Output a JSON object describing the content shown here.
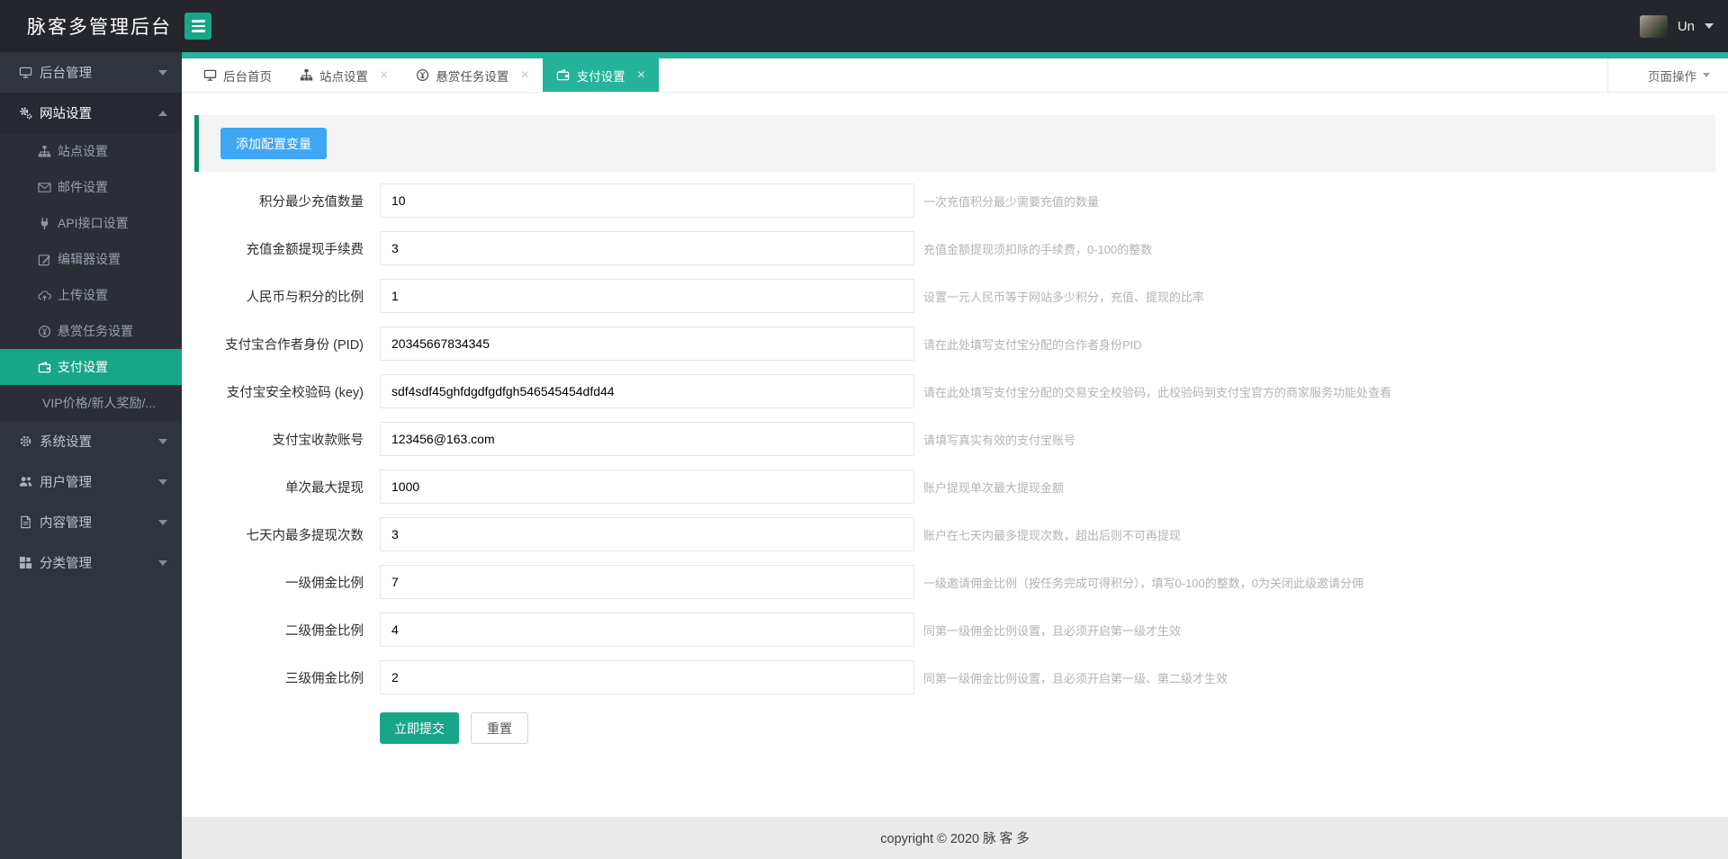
{
  "colors": {
    "accent": "#18A689",
    "tab_active": "#26B39B",
    "banner_bar": "#128D71",
    "blue": "#3FA7F3",
    "header_bg": "#24262C",
    "sidebar_bg": "#30343D"
  },
  "header": {
    "title": "脉客多管理后台",
    "menu_toggle_icon": "hamburger-icon",
    "user_name": "Un",
    "user_avatar_icon": "avatar-image"
  },
  "sidebar": {
    "groups": [
      {
        "label": "后台管理",
        "icon": "desktop-icon",
        "expanded": false
      },
      {
        "label": "网站设置",
        "icon": "gears-icon",
        "expanded": true,
        "children": [
          {
            "label": "站点设置",
            "icon": "sitemap-icon",
            "active": false
          },
          {
            "label": "邮件设置",
            "icon": "envelope-icon",
            "active": false
          },
          {
            "label": "API接口设置",
            "icon": "plug-icon",
            "active": false
          },
          {
            "label": "编辑器设置",
            "icon": "edit-icon",
            "active": false
          },
          {
            "label": "上传设置",
            "icon": "cloud-upload-icon",
            "active": false
          },
          {
            "label": "悬赏任务设置",
            "icon": "yen-circle-icon",
            "active": false
          },
          {
            "label": "支付设置",
            "icon": "wallet-icon",
            "active": true
          },
          {
            "label": "VIP价格/新人奖励/...",
            "icon": null,
            "active": false
          }
        ]
      },
      {
        "label": "系统设置",
        "icon": "gear-icon",
        "expanded": false
      },
      {
        "label": "用户管理",
        "icon": "users-icon",
        "expanded": false
      },
      {
        "label": "内容管理",
        "icon": "file-icon",
        "expanded": false
      },
      {
        "label": "分类管理",
        "icon": "grid-icon",
        "expanded": false
      }
    ]
  },
  "tabs": [
    {
      "label": "后台首页",
      "icon": "desktop-icon",
      "closable": false,
      "active": false
    },
    {
      "label": "站点设置",
      "icon": "sitemap-icon",
      "closable": true,
      "active": false
    },
    {
      "label": "悬赏任务设置",
      "icon": "yen-circle-icon",
      "closable": true,
      "active": false
    },
    {
      "label": "支付设置",
      "icon": "wallet-icon",
      "closable": true,
      "active": true
    }
  ],
  "page_actions": {
    "label": "页面操作",
    "icon": "hand-pointer-icon"
  },
  "banner": {
    "add_button_label": "添加配置变量"
  },
  "form": {
    "fields": [
      {
        "label": "积分最少充值数量",
        "value": "10",
        "hint": "一次充值积分最少需要充值的数量"
      },
      {
        "label": "充值金额提现手续费",
        "value": "3",
        "hint": "充值金额提现须扣除的手续费，0-100的整数"
      },
      {
        "label": "人民币与积分的比例",
        "value": "1",
        "hint": "设置一元人民币等于网站多少积分，充值、提现的比率"
      },
      {
        "label": "支付宝合作者身份 (PID)",
        "value": "20345667834345",
        "hint": "请在此处填写支付宝分配的合作者身份PID"
      },
      {
        "label": "支付宝安全校验码 (key)",
        "value": "sdf4sdf45ghfdgdfgdfgh546545454dfd44",
        "hint": "请在此处填写支付宝分配的交易安全校验码，此校验码到支付宝官方的商家服务功能处查看"
      },
      {
        "label": "支付宝收款账号",
        "value": "123456@163.com",
        "hint": "请填写真实有效的支付宝账号"
      },
      {
        "label": "单次最大提现",
        "value": "1000",
        "hint": "账户提现单次最大提现金额"
      },
      {
        "label": "七天内最多提现次数",
        "value": "3",
        "hint": "账户在七天内最多提现次数，超出后则不可再提现"
      },
      {
        "label": "一级佣金比例",
        "value": "7",
        "hint": "一级邀请佣金比例（按任务完成可得积分），填写0-100的整数，0为关闭此级邀请分佣"
      },
      {
        "label": "二级佣金比例",
        "value": "4",
        "hint": "同第一级佣金比例设置，且必须开启第一级才生效"
      },
      {
        "label": "三级佣金比例",
        "value": "2",
        "hint": "同第一级佣金比例设置，且必须开启第一级、第二级才生效"
      }
    ],
    "submit_label": "立即提交",
    "reset_label": "重置"
  },
  "footer": {
    "copyright": "copyright © 2020 脉 客 多"
  }
}
